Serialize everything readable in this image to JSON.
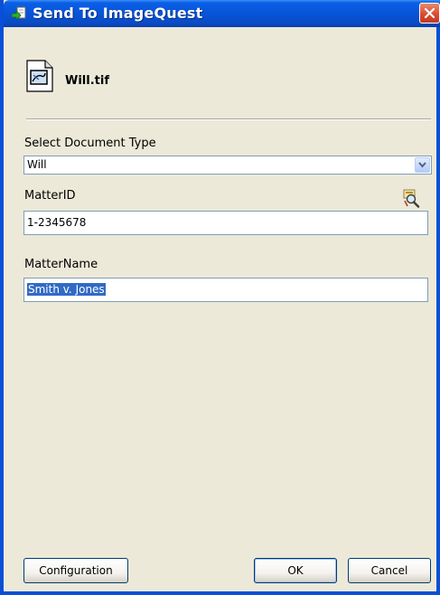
{
  "window": {
    "title": "Send To ImageQuest",
    "title_icon": "green-arrow-send-icon",
    "close_icon": "close-icon"
  },
  "file": {
    "name": "Will.tif",
    "icon": "document-file-icon"
  },
  "form": {
    "document_type_label": "Select Document Type",
    "document_type_value": "Will",
    "matter_id_label": "MatterID",
    "matter_id_value": "1-2345678",
    "matter_id_lookup_icon": "search-lookup-icon",
    "matter_name_label": "MatterName",
    "matter_name_value": "Smith v. Jones"
  },
  "buttons": {
    "configuration": "Configuration",
    "ok": "OK",
    "cancel": "Cancel"
  },
  "colors": {
    "titlebar": "#0754d8",
    "dialog_background": "#ece9d8",
    "selection": "#316ac5",
    "close_button": "#d9482c"
  }
}
